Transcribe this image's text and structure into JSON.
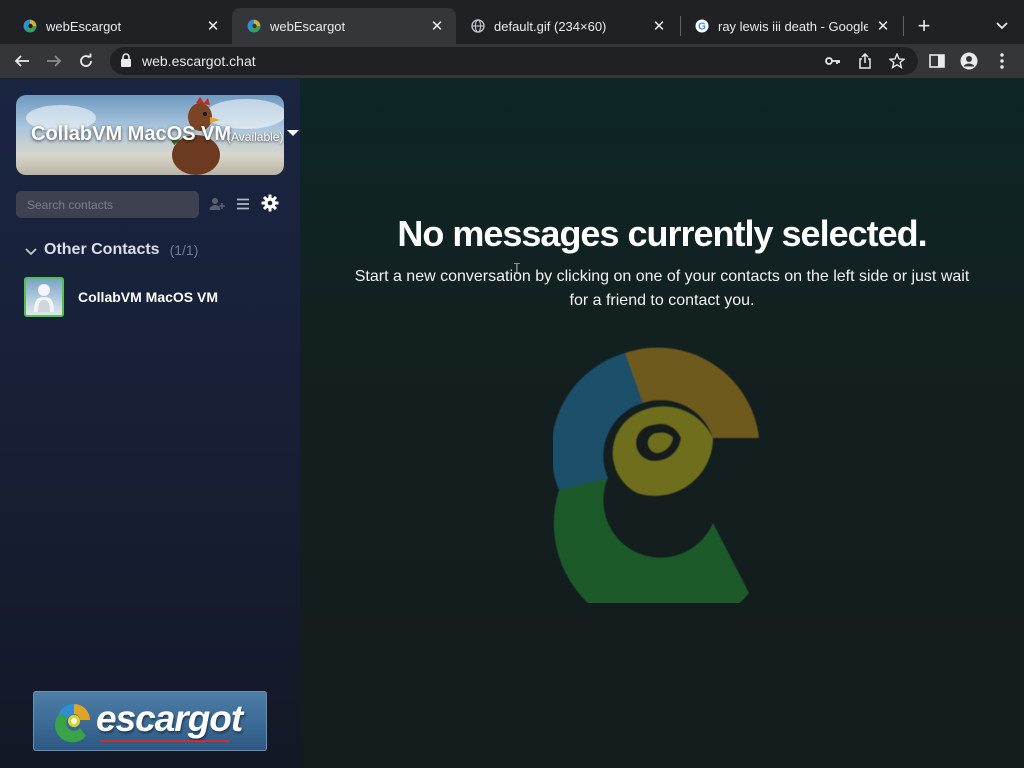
{
  "browser": {
    "tabs": [
      {
        "title": "webEscargot",
        "favicon": "escargot-favicon",
        "active": false
      },
      {
        "title": "webEscargot",
        "favicon": "escargot-favicon",
        "active": true
      },
      {
        "title": "default.gif (234×60)",
        "favicon": "globe-icon",
        "active": false
      },
      {
        "title": "ray lewis iii death - Google S",
        "favicon": "google-icon",
        "active": false
      }
    ],
    "url": "web.escargot.chat"
  },
  "sidebar": {
    "profile": {
      "name": "CollabVM MacOS VM",
      "status": "(Available)"
    },
    "search": {
      "placeholder": "Search contacts"
    },
    "group": {
      "label": "Other Contacts",
      "count": "(1/1)"
    },
    "contacts": [
      {
        "name": "CollabVM MacOS VM",
        "status_color": "#52c24a"
      }
    ],
    "logo_text": "escargot"
  },
  "main": {
    "title": "No messages currently selected.",
    "subtitle": "Start a new conversation by clicking on one of your contacts on the left side or just wait for a friend to contact you."
  },
  "colors": {
    "logo_blue": "#1e4f6a",
    "logo_orange": "#6e5a1e",
    "logo_yellow": "#6e6e1e",
    "logo_green": "#1f5a2a"
  }
}
